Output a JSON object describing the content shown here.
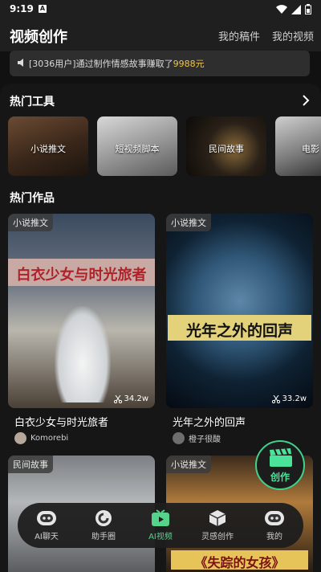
{
  "status_bar": {
    "time": "9:19",
    "notif_letter": "A"
  },
  "header": {
    "title": "视频创作",
    "my_drafts": "我的稿件",
    "my_videos": "我的视频"
  },
  "notice": {
    "prefix": "[3036用户]通过制作情感故事赚取了",
    "amount": "9988元"
  },
  "hot_tools": {
    "title": "热门工具",
    "items": [
      {
        "label": "小说推文"
      },
      {
        "label": "短视频脚本"
      },
      {
        "label": "民间故事"
      },
      {
        "label": "电影"
      }
    ]
  },
  "hot_works": {
    "title": "热门作品",
    "items": [
      {
        "tag": "小说推文",
        "poster_title": "白衣少女与时光旅者",
        "views": "34.2w",
        "title": "白衣少女与时光旅者",
        "author": "Komorebi"
      },
      {
        "tag": "小说推文",
        "poster_title": "光年之外的回声",
        "views": "33.2w",
        "title": "光年之外的回声",
        "author": "橙子很酸"
      },
      {
        "tag": "民间故事"
      },
      {
        "tag": "小说推文",
        "poster_title": "《失踪的女孩》"
      }
    ]
  },
  "fab": {
    "label": "创作"
  },
  "bottom_nav": [
    {
      "label": "AI聊天",
      "icon": "robot-icon"
    },
    {
      "label": "助手圈",
      "icon": "circle-icon"
    },
    {
      "label": "AI视频",
      "icon": "tv-icon",
      "active": true
    },
    {
      "label": "灵感创作",
      "icon": "cube-icon"
    },
    {
      "label": "我的",
      "icon": "profile-icon"
    }
  ],
  "colors": {
    "accent": "#55d38a",
    "amount": "#f3c44b",
    "bg": "#161616"
  }
}
